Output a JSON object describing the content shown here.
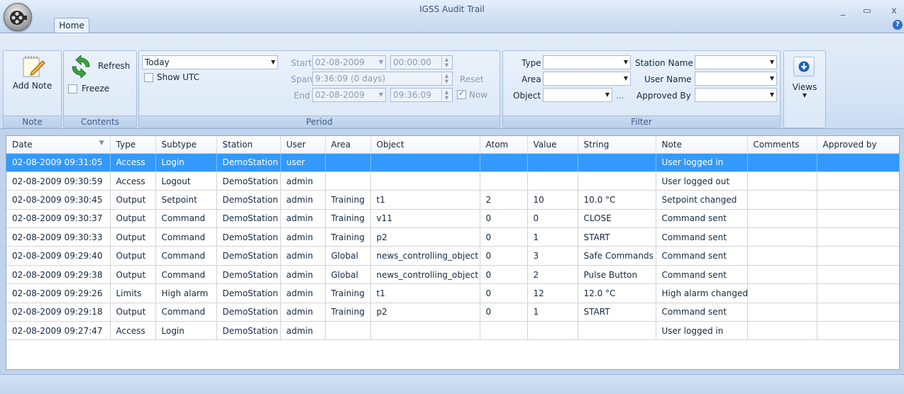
{
  "window": {
    "title": "IGSS Audit Trail",
    "minimize_glyph": "_",
    "maximize_glyph": "▭",
    "close_glyph": "x",
    "help_glyph": "?"
  },
  "tabs": [
    {
      "label": "Home",
      "active": true
    }
  ],
  "ribbon": {
    "note_group": {
      "label": "Note",
      "add_note_label": "Add Note",
      "icon": "notepad-pencil-icon"
    },
    "contents_group": {
      "label": "Contents",
      "refresh_label": "Refresh",
      "freeze_label": "Freeze",
      "freeze_checked": false,
      "icon": "refresh-arrows-icon"
    },
    "period_group": {
      "label": "Period",
      "preset": "Today",
      "show_utc_label": "Show UTC",
      "show_utc_checked": false,
      "start_label": "Start",
      "start_date": "02-08-2009",
      "start_time": "00:00:00",
      "span_label": "Span",
      "span_value": "9:36:09 (0 days)",
      "reset_label": "Reset",
      "end_label": "End",
      "end_date": "02-08-2009",
      "end_time": "09:36:09",
      "now_label": "Now",
      "now_checked": true
    },
    "filter_group": {
      "label": "Filter",
      "type_label": "Type",
      "type_value": "",
      "area_label": "Area",
      "area_value": "",
      "object_label": "Object",
      "object_value": "",
      "object_browse": "...",
      "station_name_label": "Station Name",
      "station_name_value": "",
      "user_name_label": "User Name",
      "user_name_value": "",
      "approved_by_label": "Approved By",
      "approved_by_value": ""
    },
    "views_group": {
      "label": "Views",
      "icon": "circle-down-arrow-icon"
    }
  },
  "grid": {
    "columns": [
      "Date",
      "Type",
      "Subtype",
      "Station",
      "User",
      "Area",
      "Object",
      "Atom",
      "Value",
      "String",
      "Note",
      "Comments",
      "Approved by"
    ],
    "sort_column": "Date",
    "sort_direction": "descending",
    "selected_row": 0,
    "rows": [
      [
        "02-08-2009 09:31:05",
        "Access",
        "Login",
        "DemoStation",
        "user",
        "",
        "",
        "",
        "",
        "",
        "User logged in",
        "",
        ""
      ],
      [
        "02-08-2009 09:30:59",
        "Access",
        "Logout",
        "DemoStation",
        "admin",
        "",
        "",
        "",
        "",
        "",
        "User logged out",
        "",
        ""
      ],
      [
        "02-08-2009 09:30:45",
        "Output",
        "Setpoint",
        "DemoStation",
        "admin",
        "Training",
        "t1",
        "2",
        "10",
        "10.0 °C",
        "Setpoint changed",
        "",
        ""
      ],
      [
        "02-08-2009 09:30:37",
        "Output",
        "Command",
        "DemoStation",
        "admin",
        "Training",
        "v11",
        "0",
        "0",
        "CLOSE",
        "Command sent",
        "",
        ""
      ],
      [
        "02-08-2009 09:30:33",
        "Output",
        "Command",
        "DemoStation",
        "admin",
        "Training",
        "p2",
        "0",
        "1",
        "START",
        "Command sent",
        "",
        ""
      ],
      [
        "02-08-2009 09:29:40",
        "Output",
        "Command",
        "DemoStation",
        "admin",
        "Global",
        "news_controlling_object",
        "0",
        "3",
        "Safe Commands",
        "Command sent",
        "",
        ""
      ],
      [
        "02-08-2009 09:29:38",
        "Output",
        "Command",
        "DemoStation",
        "admin",
        "Global",
        "news_controlling_object",
        "0",
        "2",
        "Pulse Button",
        "Command sent",
        "",
        ""
      ],
      [
        "02-08-2009 09:29:26",
        "Limits",
        "High alarm",
        "DemoStation",
        "admin",
        "Training",
        "t1",
        "0",
        "12",
        "12.0 °C",
        "High alarm changed",
        "",
        ""
      ],
      [
        "02-08-2009 09:29:18",
        "Output",
        "Command",
        "DemoStation",
        "admin",
        "Training",
        "p2",
        "0",
        "1",
        "START",
        "Command sent",
        "",
        ""
      ],
      [
        "02-08-2009 09:27:47",
        "Access",
        "Login",
        "DemoStation",
        "admin",
        "",
        "",
        "",
        "",
        "",
        "User logged in",
        "",
        ""
      ]
    ]
  },
  "colors": {
    "selection": "#3399ff",
    "ribbon": "#dce8f7",
    "frame": "#bfd3ec"
  }
}
